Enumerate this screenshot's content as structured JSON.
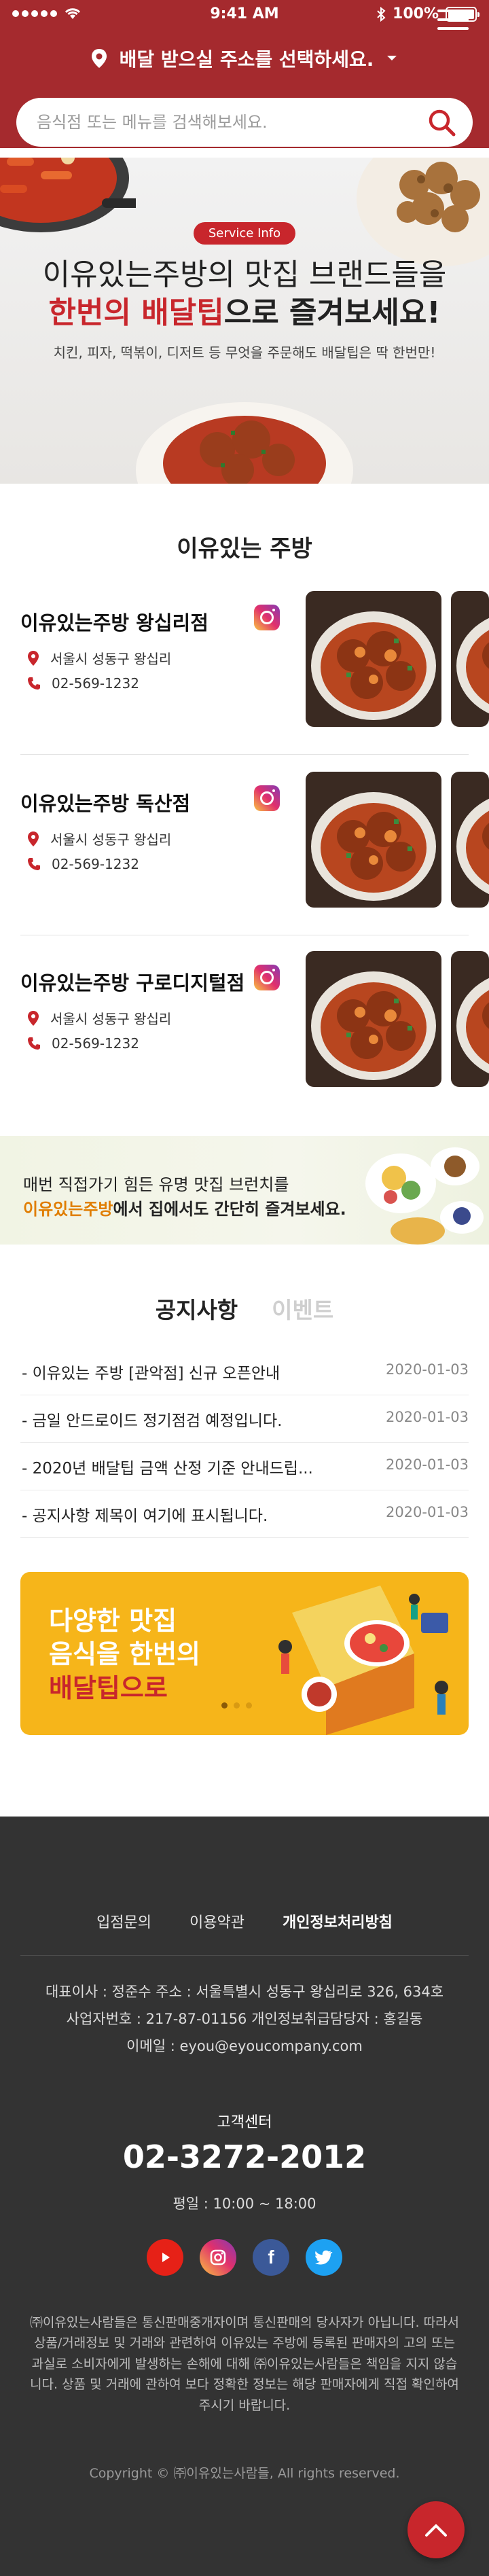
{
  "status_bar": {
    "time": "9:41 AM",
    "battery": "100%",
    "battery_level": 1.0
  },
  "header": {
    "address_label": "배달 받으실 주소를 선택하세요."
  },
  "search": {
    "placeholder": "음식점 또는 메뉴를 검색해보세요."
  },
  "hero": {
    "badge": "Service Info",
    "title_line1": "이유있는주방의 맛집 브랜드들을",
    "title_accent": "한번의 배달팁",
    "title_rest": "으로 즐겨보세요!",
    "subtitle": "치킨, 피자, 떡볶이, 디저트 등 무엇을 주문해도 배달팁은 딱 한번만!"
  },
  "brand_section": {
    "title": "이유있는 주방",
    "stores": [
      {
        "name": "이유있는주방 왕십리점",
        "address": "서울시 성동구 왕십리",
        "phone": "02-569-1232"
      },
      {
        "name": "이유있는주방 독산점",
        "address": "서울시 성동구 왕십리",
        "phone": "02-569-1232"
      },
      {
        "name": "이유있는주방 구로디지털점",
        "address": "서울시 성동구 왕십리",
        "phone": "02-569-1232"
      }
    ]
  },
  "promo": {
    "line1": "매번 직접가기 힘든 유명 맛집 브런치를",
    "line2_accent": "이유있는주방",
    "line2_rest": "에서 집에서도 간단히 즐겨보세요."
  },
  "notices": {
    "tabs": [
      "공지사항",
      "이벤트"
    ],
    "items": [
      {
        "title": "- 이유있는 주방 [관악점] 신규 오픈안내",
        "date": "2020-01-03"
      },
      {
        "title": "- 금일 안드로이드 정기점검 예정입니다.",
        "date": "2020-01-03"
      },
      {
        "title": "- 2020년 배달팁 금액 산정 기준 안내드립...",
        "date": "2020-01-03"
      },
      {
        "title": "- 공지사항 제목이 여기에 표시됩니다.",
        "date": "2020-01-03"
      }
    ]
  },
  "banner": {
    "line1": "다양한 맛집",
    "line2": "음식을 한번의",
    "line3": "배달팁으로"
  },
  "footer": {
    "links": [
      "입점문의",
      "이용약관",
      "개인정보처리방침"
    ],
    "info": [
      "대표이사 : 정준수      주소 : 서울특별시 성동구 왕십리로 326, 634호",
      "사업자번호 : 217-87-01156      개인정보취급담당자 : 홍길동",
      "이메일 : eyou@eyoucompany.com"
    ],
    "cs_label": "고객센터",
    "cs_phone": "02-3272-2012",
    "cs_hours": "평일 : 10:00 ~ 18:00",
    "disclaimer": "㈜이유있는사람들은 통신판매중개자이며 통신판매의 당사자가 아닙니다. 따라서 상품/거래정보 및 거래와 관련하여 이유있는 주방에 등록된 판매자의 고의 또는 과실로 소비자에게 발생하는 손해에 대해 ㈜이유있는사람들은 책임을 지지 않습니다. 상품 및 거래에 관하여 보다 정확한 정보는 해당 판매자에게 직접 확인하여 주시기 바랍니다.",
    "copyright": "Copyright © ㈜이유있는사람들, All rights reserved."
  },
  "colors": {
    "brand_red": "#a52a2e",
    "accent_red": "#c8262c",
    "footer_bg": "#333333",
    "banner_yellow": "#f6b51a"
  }
}
